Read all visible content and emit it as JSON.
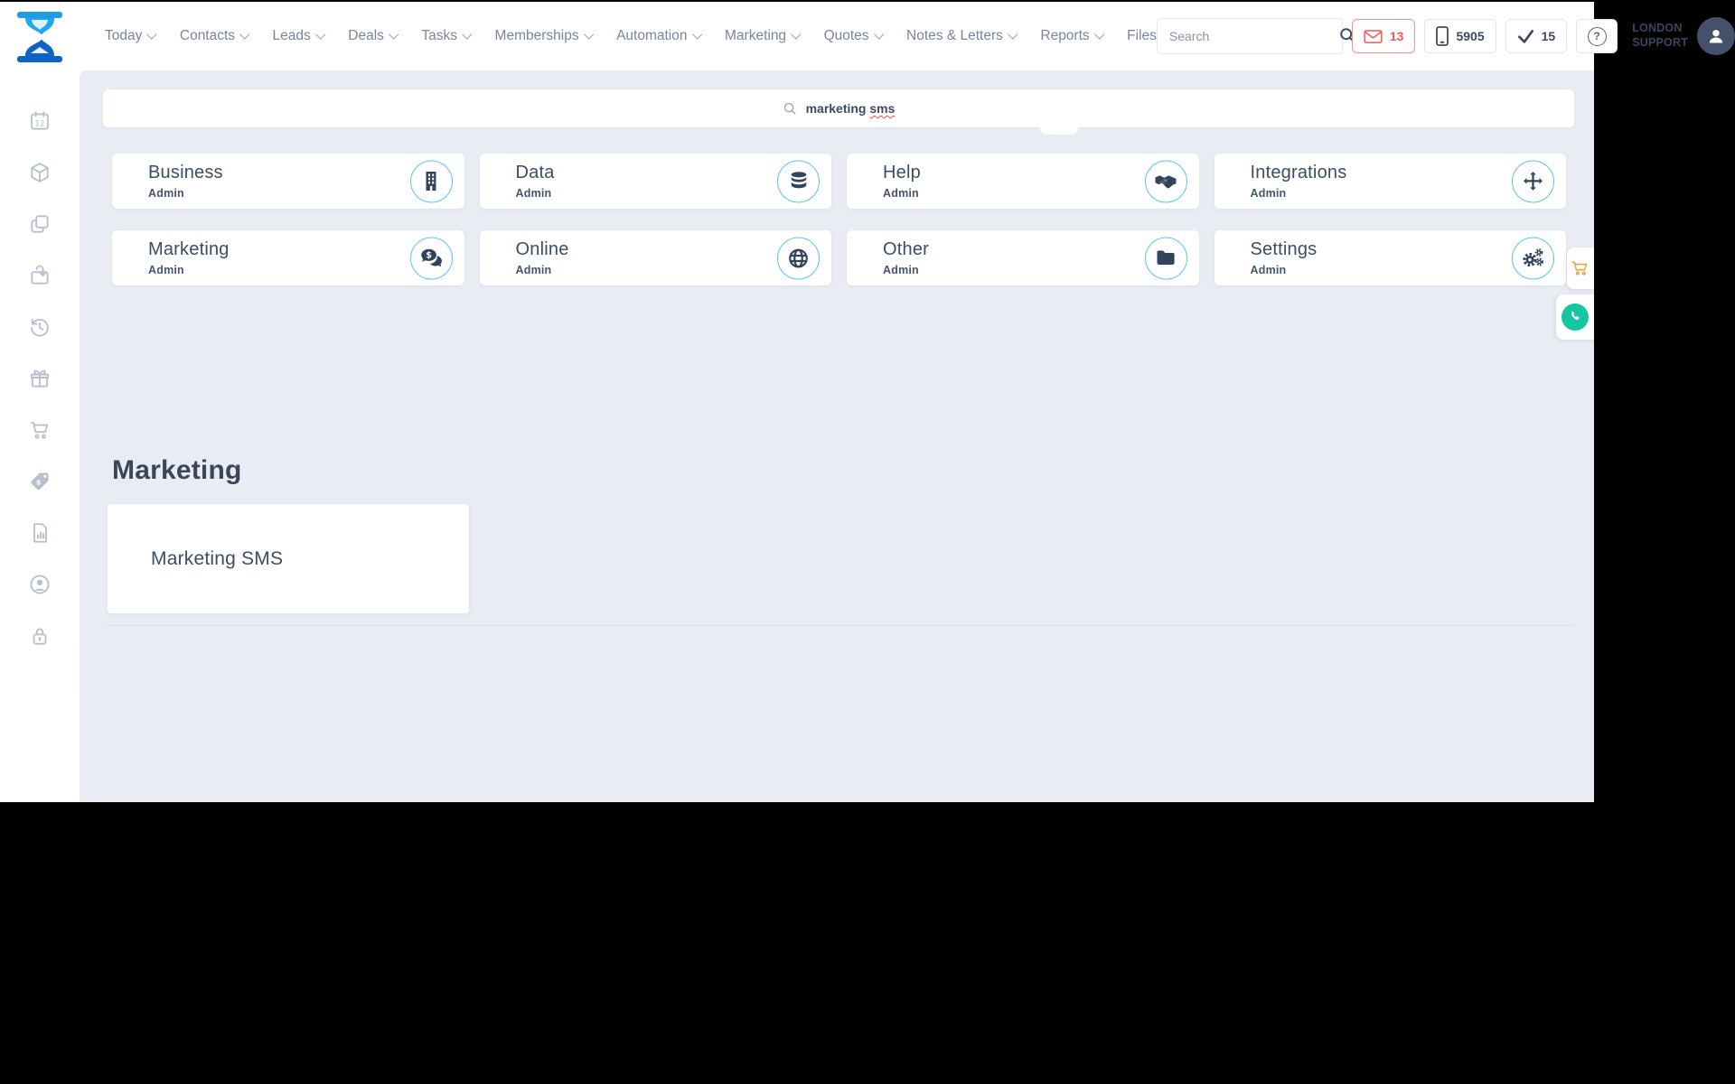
{
  "navbar": {
    "menu": [
      {
        "label": "Today"
      },
      {
        "label": "Contacts"
      },
      {
        "label": "Leads"
      },
      {
        "label": "Deals"
      },
      {
        "label": "Tasks"
      },
      {
        "label": "Memberships"
      },
      {
        "label": "Automation"
      },
      {
        "label": "Marketing"
      },
      {
        "label": "Quotes"
      },
      {
        "label": "Notes & Letters"
      },
      {
        "label": "Reports"
      },
      {
        "label": "Files"
      }
    ],
    "search_placeholder": "Search",
    "mail_count": "13",
    "phone_number": "5905",
    "task_count": "15",
    "help_mark": "?",
    "account_line1": "LONDON",
    "account_line2": "SUPPORT"
  },
  "sidebar": {
    "items": [
      "calendar-icon",
      "cube-icon",
      "clone-icon",
      "import-box-icon",
      "history-icon",
      "gift-icon",
      "cart-icon",
      "price-tag-icon",
      "report-icon",
      "user-circle-icon",
      "lock-icon"
    ],
    "calendar_day": "12"
  },
  "admin_panel": {
    "search_value_text": "marketing ",
    "search_value_misspelled": "sms",
    "cards": [
      {
        "title": "Business",
        "subtitle": "Admin",
        "icon": "building-icon"
      },
      {
        "title": "Data",
        "subtitle": "Admin",
        "icon": "database-icon"
      },
      {
        "title": "Help",
        "subtitle": "Admin",
        "icon": "handshake-icon"
      },
      {
        "title": "Integrations",
        "subtitle": "Admin",
        "icon": "move-arrows-icon"
      },
      {
        "title": "Marketing",
        "subtitle": "Admin",
        "icon": "comments-dollar-icon"
      },
      {
        "title": "Online",
        "subtitle": "Admin",
        "icon": "globe-icon"
      },
      {
        "title": "Other",
        "subtitle": "Admin",
        "icon": "folder-icon"
      },
      {
        "title": "Settings",
        "subtitle": "Admin",
        "icon": "cogs-icon"
      }
    ],
    "section_heading": "Marketing",
    "results": [
      {
        "label": "Marketing SMS"
      }
    ]
  },
  "colors": {
    "accent_blue": "#55c5f0",
    "navy": "#32435c",
    "menu_gray": "#7d829e",
    "red": "#ee5a57",
    "orange": "#f0a03f",
    "teal": "#14c7a0",
    "content_bg": "#e9ecf3",
    "sidebar_icon": "#b9c0cd"
  }
}
